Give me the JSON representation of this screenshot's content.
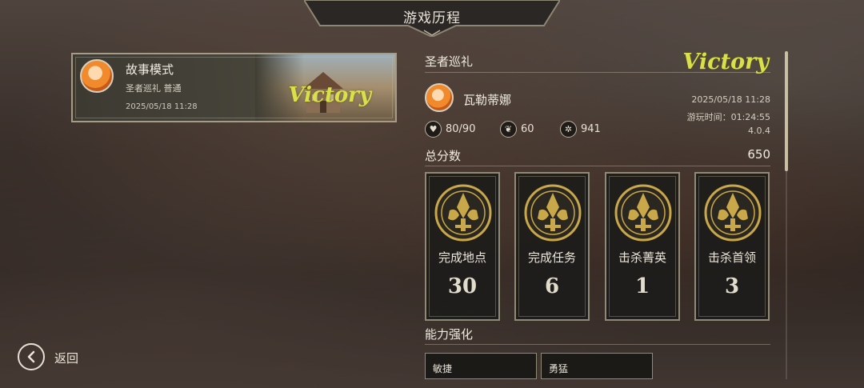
{
  "header": {
    "title": "游戏历程"
  },
  "record_card": {
    "mode": "故事模式",
    "subtitle": "圣者巡礼 普通",
    "date": "2025/05/18 11:28",
    "result": "Victory"
  },
  "detail": {
    "section_title": "圣者巡礼",
    "result": "Victory",
    "hero_name": "瓦勒蒂娜",
    "date": "2025/05/18 11:28",
    "playtime": "游玩时间：01:24:55",
    "version": "4.0.4",
    "stats": [
      {
        "icon": "heart-icon",
        "value": "80/90"
      },
      {
        "icon": "leaf-icon",
        "value": "60"
      },
      {
        "icon": "coin-icon",
        "value": "941"
      }
    ],
    "score_label": "总分数",
    "score_value": "650",
    "achievements": [
      {
        "label": "完成地点",
        "value": "30"
      },
      {
        "label": "完成任务",
        "value": "6"
      },
      {
        "label": "击杀菁英",
        "value": "1"
      },
      {
        "label": "击杀首领",
        "value": "3"
      }
    ],
    "ability_title": "能力强化",
    "abilities": [
      "敏捷",
      "勇猛"
    ]
  },
  "footer": {
    "back_label": "返回"
  },
  "colors": {
    "victory": "#d9e04a",
    "frame": "#a69c86",
    "emblem_gold": "#c9a84a"
  }
}
